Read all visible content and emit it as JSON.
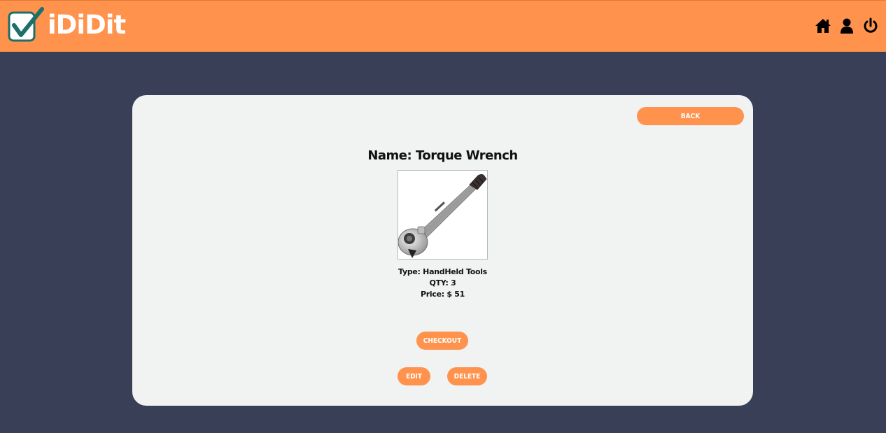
{
  "brand": {
    "name": "iDiDit",
    "logo_icon": "checkbox-check-icon",
    "accent": "#ff924c",
    "background": "#3a3f58",
    "card": "#f1f2f2"
  },
  "nav": {
    "icons": [
      "home-icon",
      "user-icon",
      "power-icon"
    ]
  },
  "item": {
    "name": "Name: Torque Wrench",
    "type": "Type: HandHeld Tools",
    "qty": "QTY: 3",
    "price": "Price: $ 51",
    "image": "torque-wrench-image"
  },
  "actions": {
    "back": "BACK",
    "checkout": "CHECKOUT",
    "edit": "EDIT",
    "delete": "DELETE"
  }
}
